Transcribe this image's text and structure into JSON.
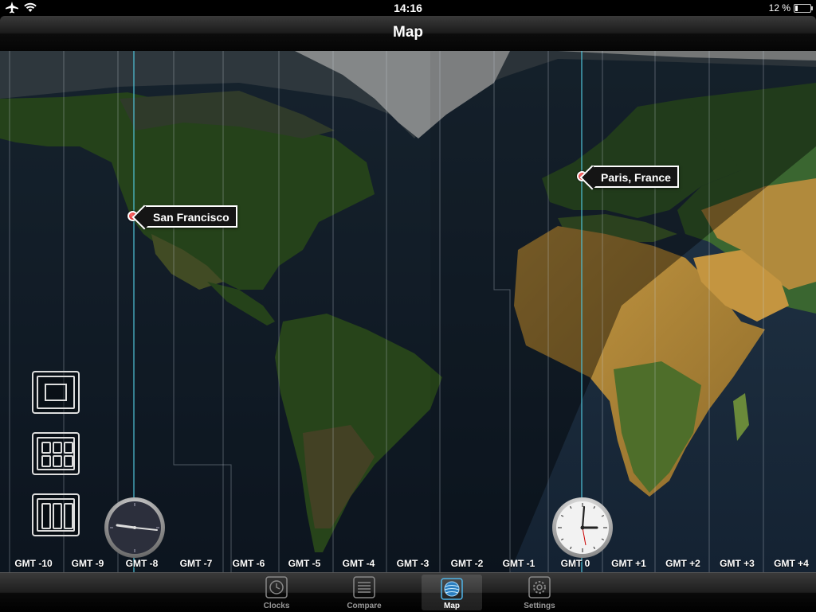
{
  "status_bar": {
    "time": "14:16",
    "battery_text": "12 %"
  },
  "nav_bar": {
    "title": "Map"
  },
  "map": {
    "gmt_labels": [
      "GMT -10",
      "GMT -9",
      "GMT -8",
      "GMT -7",
      "GMT -6",
      "GMT -5",
      "GMT -4",
      "GMT -3",
      "GMT -2",
      "GMT -1",
      "GMT 0",
      "GMT +1",
      "GMT +2",
      "GMT +3",
      "GMT +4"
    ],
    "pins": [
      {
        "label": "San Francisco"
      },
      {
        "label": "Paris, France"
      }
    ]
  },
  "clocks": [
    {
      "city": "San Francisco",
      "style": "dark",
      "hour": 5,
      "minute": 16
    },
    {
      "city": "Paris, France",
      "style": "light",
      "hour": 14,
      "minute": 16
    }
  ],
  "tab_bar": {
    "tabs": [
      {
        "label": "Clocks",
        "icon": "clock-icon",
        "selected": false
      },
      {
        "label": "Compare",
        "icon": "list-icon",
        "selected": false
      },
      {
        "label": "Map",
        "icon": "globe-icon",
        "selected": true
      },
      {
        "label": "Settings",
        "icon": "gear-icon",
        "selected": false
      }
    ]
  },
  "colors": {
    "pin": "#d00000",
    "ocean": "#18293a",
    "land": "#3d6b2b",
    "desert": "#b08a3a",
    "ice": "#d8dcdc"
  }
}
